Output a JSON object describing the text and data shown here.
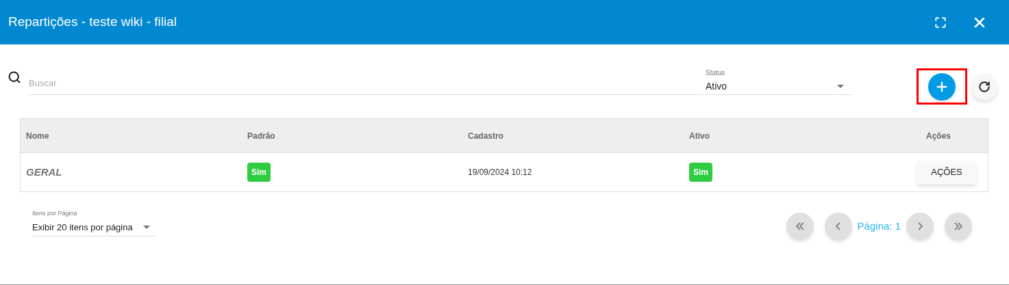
{
  "window": {
    "title": "Repartições - teste wiki - filial"
  },
  "search": {
    "placeholder": "Buscar"
  },
  "status_filter": {
    "label": "Status",
    "value": "Ativo"
  },
  "add_button": {
    "highlighted": true
  },
  "table": {
    "columns": [
      "Nome",
      "Padrão",
      "Cadastro",
      "Ativo",
      "Ações"
    ],
    "rows": [
      {
        "nome": "GERAL",
        "padrao": "Sim",
        "cadastro": "19/09/2024 10:12",
        "ativo": "Sim",
        "acoes": "AÇÕES"
      }
    ]
  },
  "page_size": {
    "label": "Itens por Página",
    "value": "Exibir 20 itens por página"
  },
  "pagination": {
    "label": "Página: 1",
    "first_disabled": true,
    "prev_disabled": true,
    "next_disabled": true,
    "last_disabled": true
  }
}
